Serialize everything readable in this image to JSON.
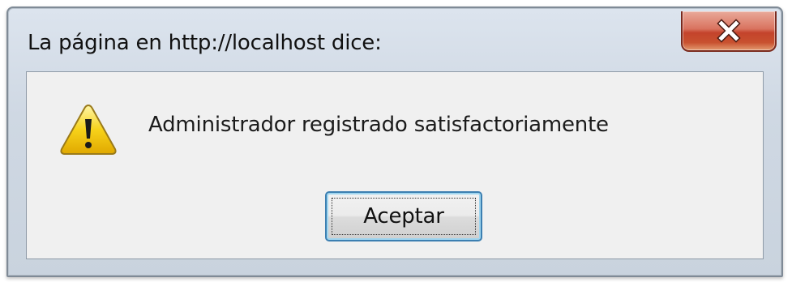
{
  "dialog": {
    "title": "La página en http://localhost dice:",
    "message": "Administrador registrado satisfactoriamente",
    "ok_label": "Aceptar",
    "icon": "warning-icon",
    "close_icon": "close-icon"
  },
  "colors": {
    "close_button": "#c4432b",
    "button_border": "#3c7fb1",
    "warning_yellow": "#f5c400"
  }
}
